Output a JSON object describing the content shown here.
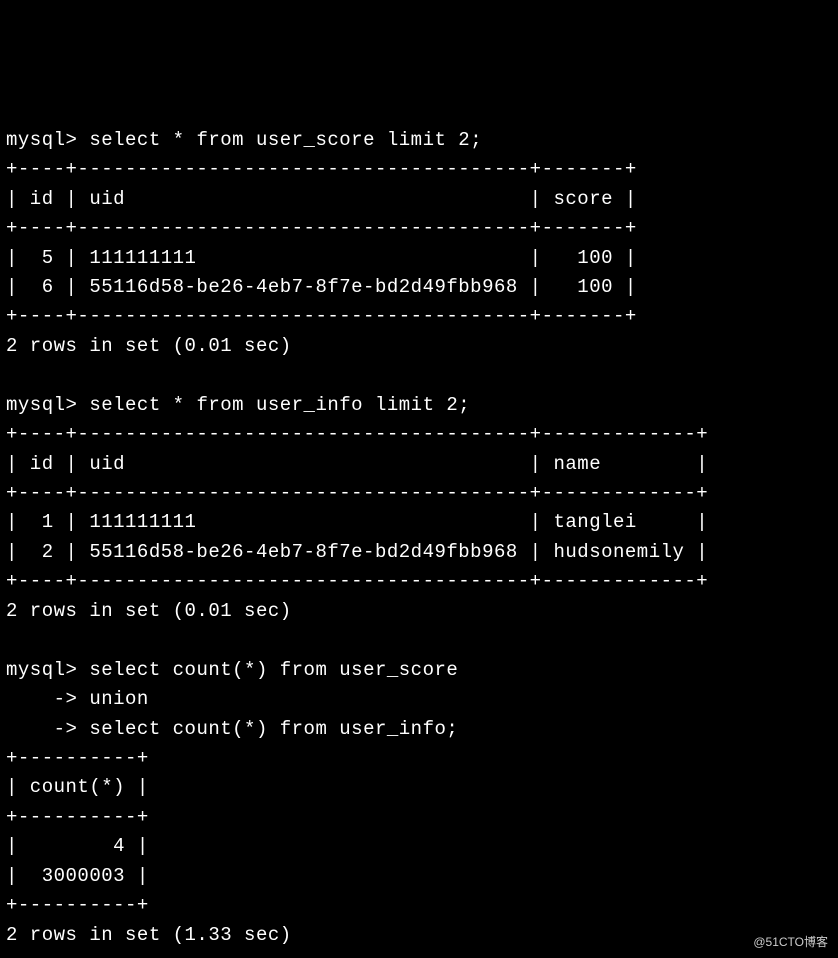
{
  "session": {
    "prompt": "mysql>",
    "continuation": "    ->",
    "queries": [
      {
        "sql": "select * from user_score limit 2;",
        "table": {
          "border_top": "+----+--------------------------------------+-------+",
          "header_line": "| id | uid                                  | score |",
          "border_mid": "+----+--------------------------------------+-------+",
          "rows": [
            "|  5 | 111111111                            |   100 |",
            "|  6 | 55116d58-be26-4eb7-8f7e-bd2d49fbb968 |   100 |"
          ],
          "border_bot": "+----+--------------------------------------+-------+"
        },
        "footer": "2 rows in set (0.01 sec)"
      },
      {
        "sql": "select * from user_info limit 2;",
        "table": {
          "border_top": "+----+--------------------------------------+-------------+",
          "header_line": "| id | uid                                  | name        |",
          "border_mid": "+----+--------------------------------------+-------------+",
          "rows": [
            "|  1 | 111111111                            | tanglei     |",
            "|  2 | 55116d58-be26-4eb7-8f7e-bd2d49fbb968 | hudsonemily |"
          ],
          "border_bot": "+----+--------------------------------------+-------------+"
        },
        "footer": "2 rows in set (0.01 sec)"
      },
      {
        "sql_lines": [
          "select count(*) from user_score",
          "union",
          "select count(*) from user_info;"
        ],
        "table": {
          "border_top": "+----------+",
          "header_line": "| count(*) |",
          "border_mid": "+----------+",
          "rows": [
            "|        4 |",
            "|  3000003 |"
          ],
          "border_bot": "+----------+"
        },
        "footer": "2 rows in set (1.33 sec)"
      }
    ]
  },
  "watermark": "@51CTO博客"
}
